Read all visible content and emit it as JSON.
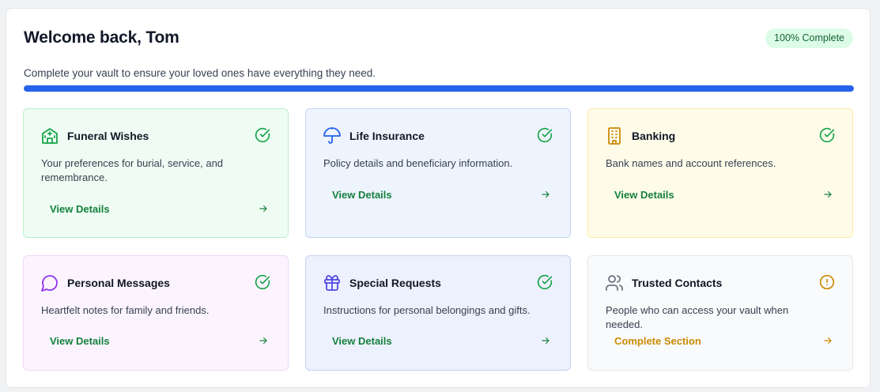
{
  "header": {
    "title": "Welcome back, Tom",
    "badge": "100% Complete",
    "subtitle": "Complete your vault to ensure your loved ones have everything they need.",
    "progress": 1.0
  },
  "colors": {
    "accent": "#2563eb",
    "complete": "#16a34a",
    "link": "#15803d",
    "warning": "#ca8a04"
  },
  "cards": [
    {
      "title": "Funeral Wishes",
      "icon": "building-icon",
      "status": "complete",
      "description": "Your preferences for burial, service, and remembrance.",
      "action": "View Details"
    },
    {
      "title": "Life Insurance",
      "icon": "umbrella-icon",
      "status": "complete",
      "description": "Policy details and beneficiary information.",
      "action": "View Details"
    },
    {
      "title": "Banking",
      "icon": "bank-building-icon",
      "status": "complete",
      "description": "Bank names and account references.",
      "action": "View Details"
    },
    {
      "title": "Personal Messages",
      "icon": "message-circle-icon",
      "status": "complete",
      "description": "Heartfelt notes for family and friends.",
      "action": "View Details"
    },
    {
      "title": "Special Requests",
      "icon": "gift-icon",
      "status": "complete",
      "description": "Instructions for personal belongings and gifts.",
      "action": "View Details"
    },
    {
      "title": "Trusted Contacts",
      "icon": "users-icon",
      "status": "incomplete",
      "description": "People who can access your vault when needed.",
      "action": "Complete Section"
    }
  ]
}
